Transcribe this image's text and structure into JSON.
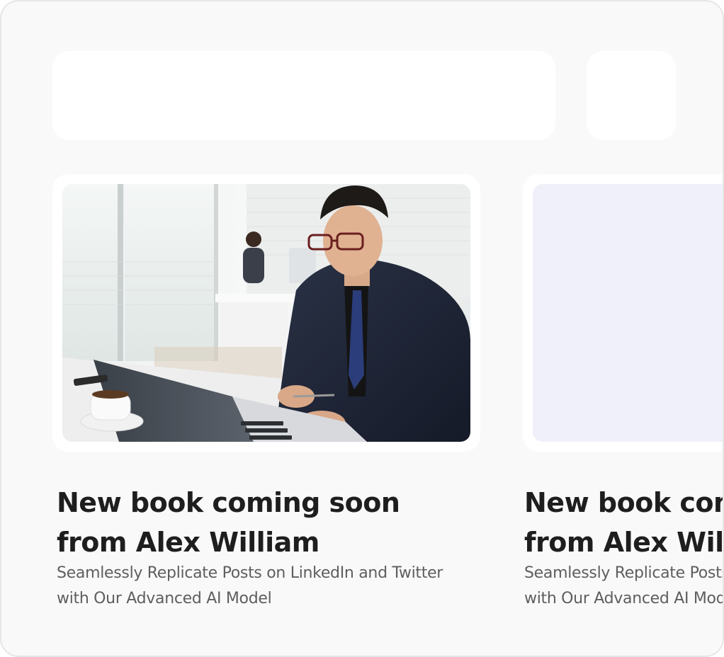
{
  "posts": [
    {
      "title": "New book coming soon from Alex William",
      "description": "Seamlessly Replicate Posts on LinkedIn and Twitter with Our Advanced AI Model"
    },
    {
      "title": "New book coming soon from Alex William",
      "description": "Seamlessly Replicate Posts on LinkedIn and Twitter with Our Advanced AI Model"
    }
  ],
  "colors": {
    "page_background": "#f9f9f9",
    "card_background": "#ffffff",
    "placeholder": "#f0f0fa",
    "title_text": "#1e1e1e",
    "description_text": "#5e5e5e"
  }
}
